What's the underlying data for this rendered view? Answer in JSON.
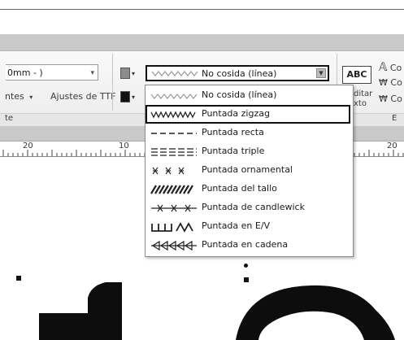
{
  "ribbon": {
    "units_combo_value": "0mm - )",
    "ttf_tab_prefix": "ntes",
    "ttf_settings_label": "Ajustes de TTF",
    "group_label_left": "te",
    "edit_text_line1": "ditar",
    "edit_text_line2": "xto",
    "abc_label": "ABC",
    "right_item_1": "Co",
    "right_item_2": "Co",
    "right_item_3": "Co",
    "group_label_right": "E",
    "thread_color_1": "#8c8c8c",
    "thread_color_2": "#111111"
  },
  "stitch_select": {
    "value": "No cosida (línea)"
  },
  "stitch_options": [
    {
      "label": "No cosida (línea)",
      "icon": "no-stitch-line-icon"
    },
    {
      "label": "Puntada zigzag",
      "icon": "zigzag-stitch-icon",
      "selected": true
    },
    {
      "label": "Puntada recta",
      "icon": "running-stitch-icon"
    },
    {
      "label": "Puntada triple",
      "icon": "triple-stitch-icon"
    },
    {
      "label": "Puntada ornamental",
      "icon": "motif-stitch-icon"
    },
    {
      "label": "Puntada del tallo",
      "icon": "stem-stitch-icon"
    },
    {
      "label": "Puntada de candlewick",
      "icon": "candlewick-stitch-icon"
    },
    {
      "label": "Puntada en E/V",
      "icon": "ev-stitch-icon"
    },
    {
      "label": "Puntada en cadena",
      "icon": "chain-stitch-icon"
    }
  ],
  "ruler": {
    "label_a": "20",
    "label_b": "10",
    "label_c": "20"
  }
}
